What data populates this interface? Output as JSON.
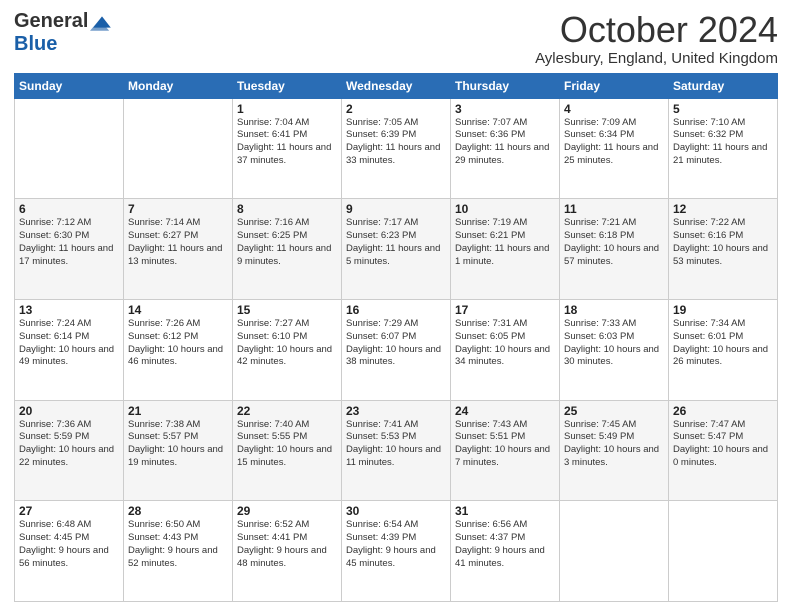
{
  "header": {
    "logo_general": "General",
    "logo_blue": "Blue",
    "month": "October 2024",
    "location": "Aylesbury, England, United Kingdom"
  },
  "days_of_week": [
    "Sunday",
    "Monday",
    "Tuesday",
    "Wednesday",
    "Thursday",
    "Friday",
    "Saturday"
  ],
  "weeks": [
    [
      {
        "day": "",
        "info": ""
      },
      {
        "day": "",
        "info": ""
      },
      {
        "day": "1",
        "info": "Sunrise: 7:04 AM\nSunset: 6:41 PM\nDaylight: 11 hours and 37 minutes."
      },
      {
        "day": "2",
        "info": "Sunrise: 7:05 AM\nSunset: 6:39 PM\nDaylight: 11 hours and 33 minutes."
      },
      {
        "day": "3",
        "info": "Sunrise: 7:07 AM\nSunset: 6:36 PM\nDaylight: 11 hours and 29 minutes."
      },
      {
        "day": "4",
        "info": "Sunrise: 7:09 AM\nSunset: 6:34 PM\nDaylight: 11 hours and 25 minutes."
      },
      {
        "day": "5",
        "info": "Sunrise: 7:10 AM\nSunset: 6:32 PM\nDaylight: 11 hours and 21 minutes."
      }
    ],
    [
      {
        "day": "6",
        "info": "Sunrise: 7:12 AM\nSunset: 6:30 PM\nDaylight: 11 hours and 17 minutes."
      },
      {
        "day": "7",
        "info": "Sunrise: 7:14 AM\nSunset: 6:27 PM\nDaylight: 11 hours and 13 minutes."
      },
      {
        "day": "8",
        "info": "Sunrise: 7:16 AM\nSunset: 6:25 PM\nDaylight: 11 hours and 9 minutes."
      },
      {
        "day": "9",
        "info": "Sunrise: 7:17 AM\nSunset: 6:23 PM\nDaylight: 11 hours and 5 minutes."
      },
      {
        "day": "10",
        "info": "Sunrise: 7:19 AM\nSunset: 6:21 PM\nDaylight: 11 hours and 1 minute."
      },
      {
        "day": "11",
        "info": "Sunrise: 7:21 AM\nSunset: 6:18 PM\nDaylight: 10 hours and 57 minutes."
      },
      {
        "day": "12",
        "info": "Sunrise: 7:22 AM\nSunset: 6:16 PM\nDaylight: 10 hours and 53 minutes."
      }
    ],
    [
      {
        "day": "13",
        "info": "Sunrise: 7:24 AM\nSunset: 6:14 PM\nDaylight: 10 hours and 49 minutes."
      },
      {
        "day": "14",
        "info": "Sunrise: 7:26 AM\nSunset: 6:12 PM\nDaylight: 10 hours and 46 minutes."
      },
      {
        "day": "15",
        "info": "Sunrise: 7:27 AM\nSunset: 6:10 PM\nDaylight: 10 hours and 42 minutes."
      },
      {
        "day": "16",
        "info": "Sunrise: 7:29 AM\nSunset: 6:07 PM\nDaylight: 10 hours and 38 minutes."
      },
      {
        "day": "17",
        "info": "Sunrise: 7:31 AM\nSunset: 6:05 PM\nDaylight: 10 hours and 34 minutes."
      },
      {
        "day": "18",
        "info": "Sunrise: 7:33 AM\nSunset: 6:03 PM\nDaylight: 10 hours and 30 minutes."
      },
      {
        "day": "19",
        "info": "Sunrise: 7:34 AM\nSunset: 6:01 PM\nDaylight: 10 hours and 26 minutes."
      }
    ],
    [
      {
        "day": "20",
        "info": "Sunrise: 7:36 AM\nSunset: 5:59 PM\nDaylight: 10 hours and 22 minutes."
      },
      {
        "day": "21",
        "info": "Sunrise: 7:38 AM\nSunset: 5:57 PM\nDaylight: 10 hours and 19 minutes."
      },
      {
        "day": "22",
        "info": "Sunrise: 7:40 AM\nSunset: 5:55 PM\nDaylight: 10 hours and 15 minutes."
      },
      {
        "day": "23",
        "info": "Sunrise: 7:41 AM\nSunset: 5:53 PM\nDaylight: 10 hours and 11 minutes."
      },
      {
        "day": "24",
        "info": "Sunrise: 7:43 AM\nSunset: 5:51 PM\nDaylight: 10 hours and 7 minutes."
      },
      {
        "day": "25",
        "info": "Sunrise: 7:45 AM\nSunset: 5:49 PM\nDaylight: 10 hours and 3 minutes."
      },
      {
        "day": "26",
        "info": "Sunrise: 7:47 AM\nSunset: 5:47 PM\nDaylight: 10 hours and 0 minutes."
      }
    ],
    [
      {
        "day": "27",
        "info": "Sunrise: 6:48 AM\nSunset: 4:45 PM\nDaylight: 9 hours and 56 minutes."
      },
      {
        "day": "28",
        "info": "Sunrise: 6:50 AM\nSunset: 4:43 PM\nDaylight: 9 hours and 52 minutes."
      },
      {
        "day": "29",
        "info": "Sunrise: 6:52 AM\nSunset: 4:41 PM\nDaylight: 9 hours and 48 minutes."
      },
      {
        "day": "30",
        "info": "Sunrise: 6:54 AM\nSunset: 4:39 PM\nDaylight: 9 hours and 45 minutes."
      },
      {
        "day": "31",
        "info": "Sunrise: 6:56 AM\nSunset: 4:37 PM\nDaylight: 9 hours and 41 minutes."
      },
      {
        "day": "",
        "info": ""
      },
      {
        "day": "",
        "info": ""
      }
    ]
  ]
}
